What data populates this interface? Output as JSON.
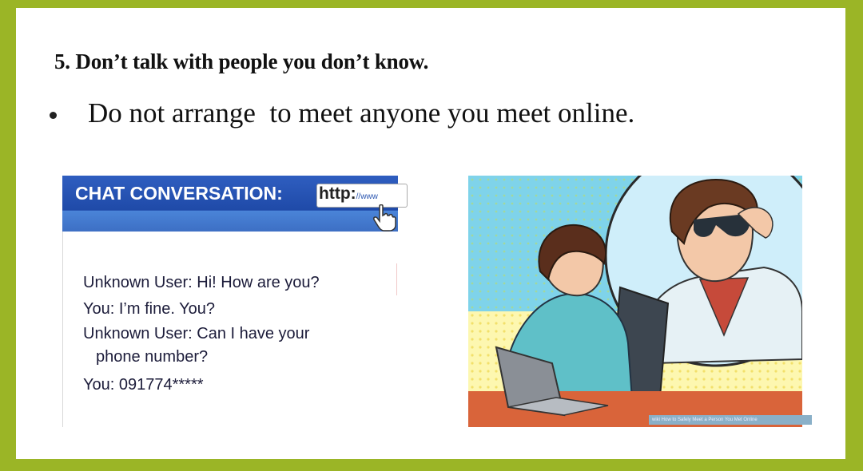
{
  "slide": {
    "heading": "5. Don’t talk with people you don’t know.",
    "bullet": "Do not arrange  to meet anyone you meet online."
  },
  "chat_card": {
    "title": "CHAT CONVERSATION:",
    "url_main": "http:",
    "url_small": "//www",
    "lines": [
      "Unknown User: Hi! How are you?",
      "You: I’m fine. You?"
    ],
    "wrapped_line": {
      "first": "Unknown User: Can I have your",
      "second": "phone number?"
    },
    "last_line": "You: 091774*****"
  },
  "illustration": {
    "watermark": "wiki How to Safely Meet a Person You Met Online"
  },
  "colors": {
    "border": "#9bb526",
    "chat_header": "#1f4aa8"
  }
}
